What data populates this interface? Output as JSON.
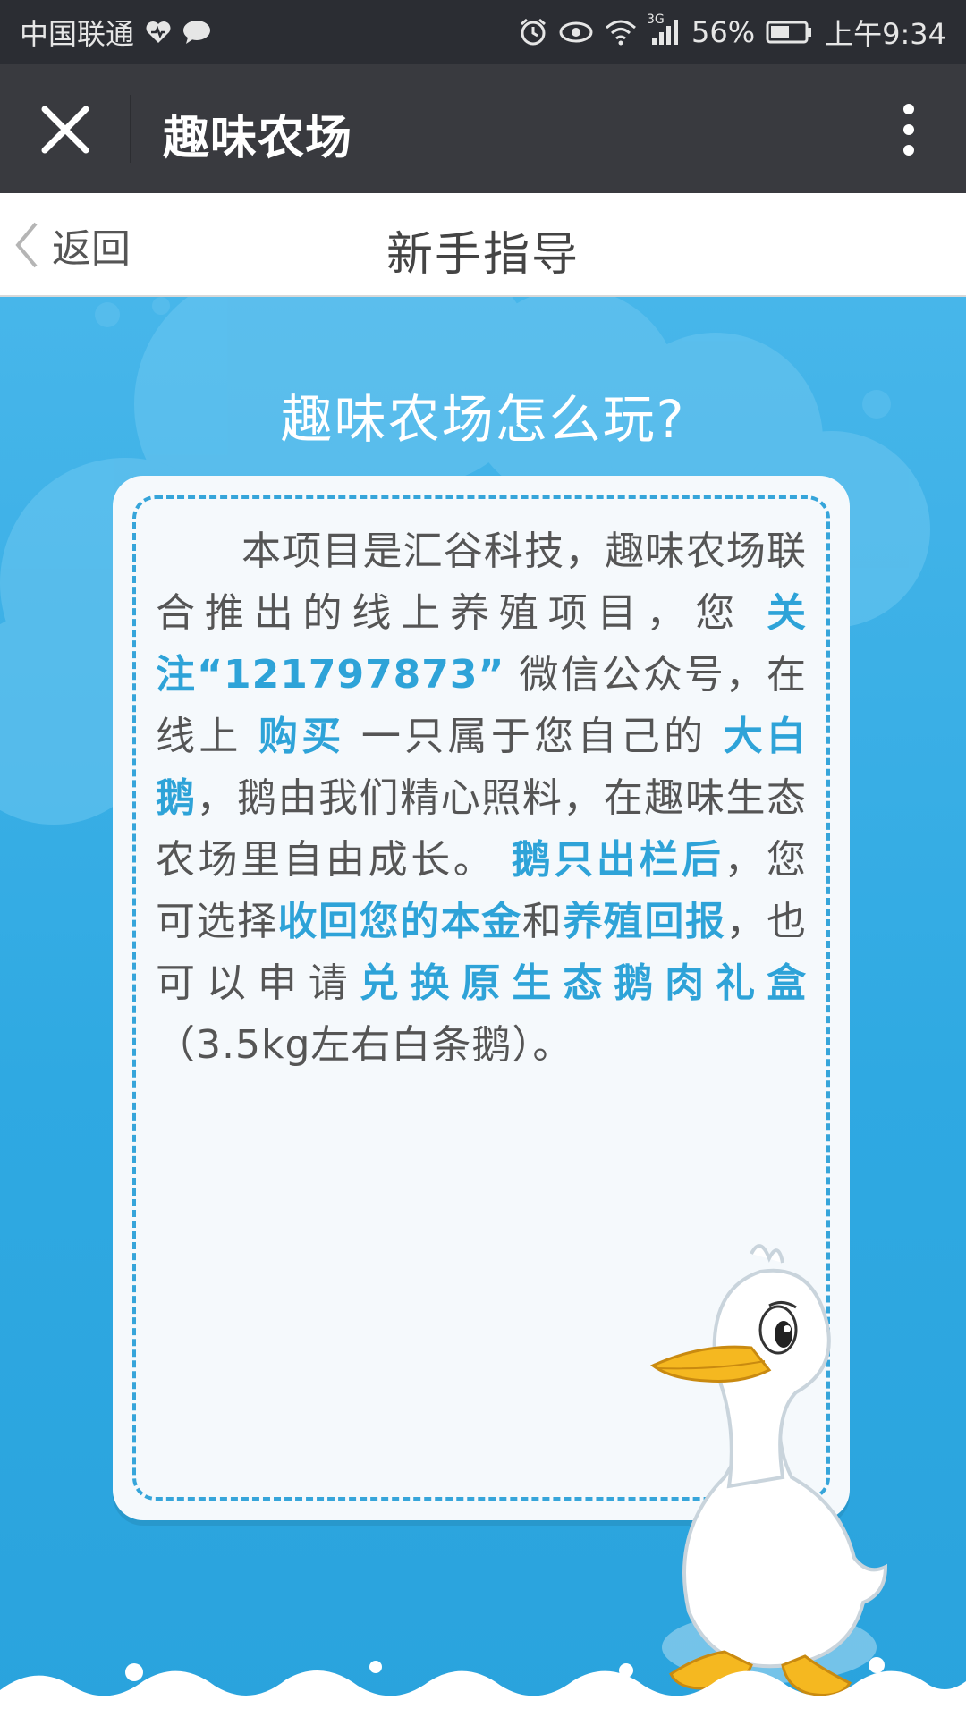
{
  "status_bar": {
    "carrier": "中国联通",
    "network": "3G",
    "battery": "56%",
    "time": "上午9:34"
  },
  "title_bar": {
    "title": "趣味农场"
  },
  "nav": {
    "back_label": "返回",
    "page_title": "新手指导"
  },
  "content": {
    "heading": "趣味农场怎么玩?",
    "card": {
      "segments": [
        {
          "text": "本项目是汇谷科技，趣味农场联合推出的线上养殖项目，您 ",
          "highlight": false
        },
        {
          "text": "关注“121797873”",
          "highlight": true
        },
        {
          "text": " 微信公众号，在线上 ",
          "highlight": false
        },
        {
          "text": "购买",
          "highlight": true
        },
        {
          "text": " 一只属于您自己的 ",
          "highlight": false
        },
        {
          "text": "大白鹅",
          "highlight": true
        },
        {
          "text": "，鹅由我们精心照料，在趣味生态农场里自由成长。 ",
          "highlight": false
        },
        {
          "text": "鹅只出栏后",
          "highlight": true
        },
        {
          "text": "，您可选择",
          "highlight": false
        },
        {
          "text": "收回您的本金",
          "highlight": true
        },
        {
          "text": "和",
          "highlight": false
        },
        {
          "text": "养殖回报",
          "highlight": true
        },
        {
          "text": "，也可以申请",
          "highlight": false
        },
        {
          "text": "兑换原生态鹅肉礼盒",
          "highlight": true
        },
        {
          "text": "（3.5kg左右白条鹅）。",
          "highlight": false
        }
      ]
    }
  },
  "colors": {
    "status_bar_bg": "#2b2d33",
    "title_bar_bg": "#393a3f",
    "accent": "#2ea3d8",
    "background": "#2fa8e0"
  },
  "icons": [
    "heart-icon",
    "chat-icon",
    "alarm-icon",
    "eye-icon",
    "wifi-icon",
    "signal-icon",
    "battery-icon",
    "close-icon",
    "more-icon",
    "back-chevron-icon",
    "duck-illustration"
  ]
}
